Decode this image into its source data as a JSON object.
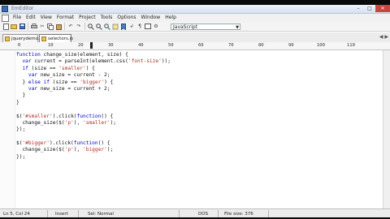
{
  "title": "EmEditor",
  "menu": [
    "File",
    "Edit",
    "View",
    "Format",
    "Project",
    "Tools",
    "Options",
    "Window",
    "Help"
  ],
  "language": "JavaScript",
  "tabs": [
    {
      "label": "jquerydemo.html"
    },
    {
      "label": "selectors.js"
    }
  ],
  "ruler": {
    "labels": [
      "0",
      "10",
      "20",
      "30",
      "40",
      "50",
      "60",
      "70",
      "80",
      "90",
      "100",
      "110"
    ],
    "cursor_col": 24
  },
  "code_lines": [
    "function change_size(element, size) {",
    "  var current = parseInt(element.css('font-size'));",
    "  if (size == 'smaller') {",
    "    var new_size = current - 2;",
    "  } else if (size == 'bigger') {",
    "    var new_size = current + 2;",
    "  }",
    "}",
    "",
    "$('#smaller').click(function() {",
    "  change_size($('p'), 'smaller');",
    "});",
    "",
    "$('#bigger').click(function() {",
    "  change_size($('p'), 'bigger');",
    "});"
  ],
  "status": {
    "position": "Ln 5, Col 24",
    "mode": "Insert",
    "selection": "Sel: Normal",
    "encoding": "DOS",
    "file_size": "File size: 376"
  },
  "colors": {
    "keyword": "#0000c8",
    "string": "#b0302a",
    "close": "#c9463d"
  }
}
